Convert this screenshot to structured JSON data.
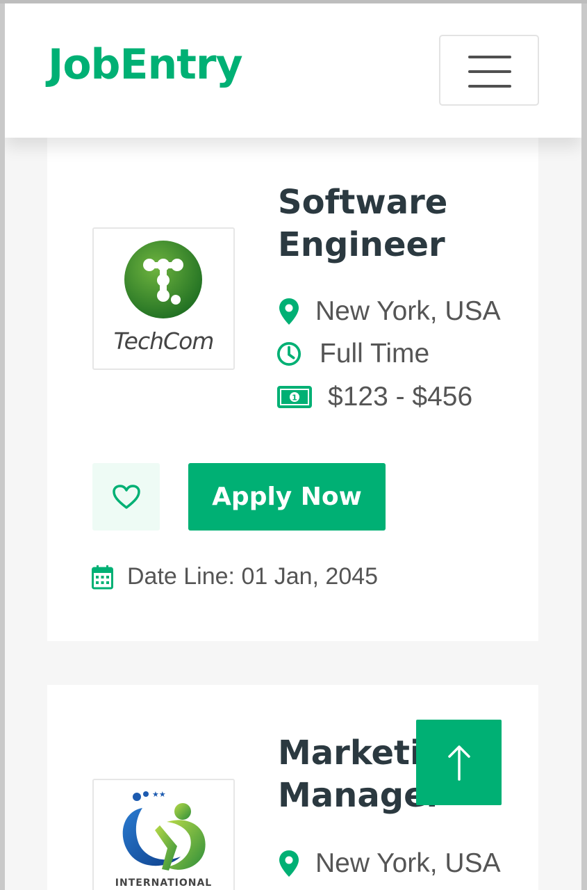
{
  "brand": {
    "name": "JobEntry"
  },
  "colors": {
    "accent": "#00b074",
    "heading": "#2b3940",
    "text": "#555555"
  },
  "jobs": [
    {
      "title_line1": "Software",
      "title_line2": "Engineer",
      "company_logo_text": "TechCom",
      "location": "New York, USA",
      "type": "Full Time",
      "salary": "$123 - $456",
      "apply_label": "Apply Now",
      "deadline": "Date Line: 01 Jan, 2045"
    },
    {
      "title_line1": "Marketing",
      "title_line2": "Manager",
      "company_logo_text": "INTERNATIONAL",
      "location": "New York, USA"
    }
  ],
  "icons": {
    "menu": "hamburger-icon",
    "location": "map-marker-icon",
    "time": "clock-icon",
    "salary": "money-bill-icon",
    "favorite": "heart-icon",
    "date": "calendar-icon",
    "back_to_top": "arrow-up-icon"
  }
}
